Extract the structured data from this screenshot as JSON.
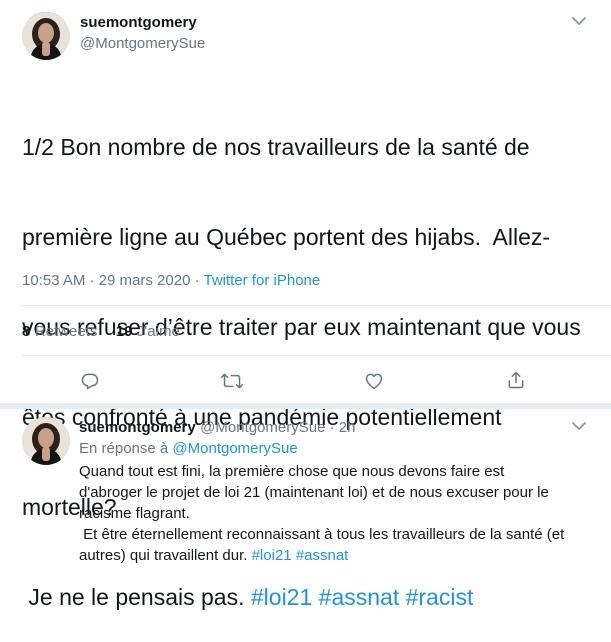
{
  "tweet": {
    "display_name": "suemontgomery",
    "handle": "@MontgomerySue",
    "text_lines": [
      "1/2 Bon nombre de nos travailleurs de la santé de",
      "première ligne au Québec portent des hijabs.  Allez-",
      "vous refuser d’être traiter par eux maintenant que vous",
      "êtes confronté à une pandémie potentiellement",
      "mortelle?"
    ],
    "last_line_prefix": " Je ne le pensais pas. ",
    "hashtags": [
      "#loi21",
      "#assnat",
      "#racist"
    ],
    "timestamp": "10:53 AM · 29 mars 2020 · ",
    "source": "Twitter for iPhone",
    "retweets_count": "8",
    "retweets_label": "Retweets",
    "likes_count": "19",
    "likes_label": "J'aime",
    "actions": [
      "reply-icon",
      "retweet-icon",
      "like-icon",
      "share-icon"
    ],
    "menu_icon": "chevron-down-icon"
  },
  "reply": {
    "display_name": "suemontgomery",
    "handle_time": "@MontgomerySue · 2h",
    "replying_to_prefix": "En réponse à ",
    "replying_to_handle": "@MontgomerySue",
    "text": "Quand tout est fini, la première chose que nous devons faire est\nd'abroger le projet de loi 21 (maintenant loi) et de nous excuser pour le\nracisme flagrant.\n Et être éternellement reconnaissant à tous les travailleurs de la santé (et\nautres) qui travaillent dur. ",
    "hashtags": [
      "#loi21",
      "#assnat"
    ]
  },
  "colors": {
    "link": "#1b95e0",
    "secondary": "#657786",
    "divider": "#e6ecf0"
  }
}
